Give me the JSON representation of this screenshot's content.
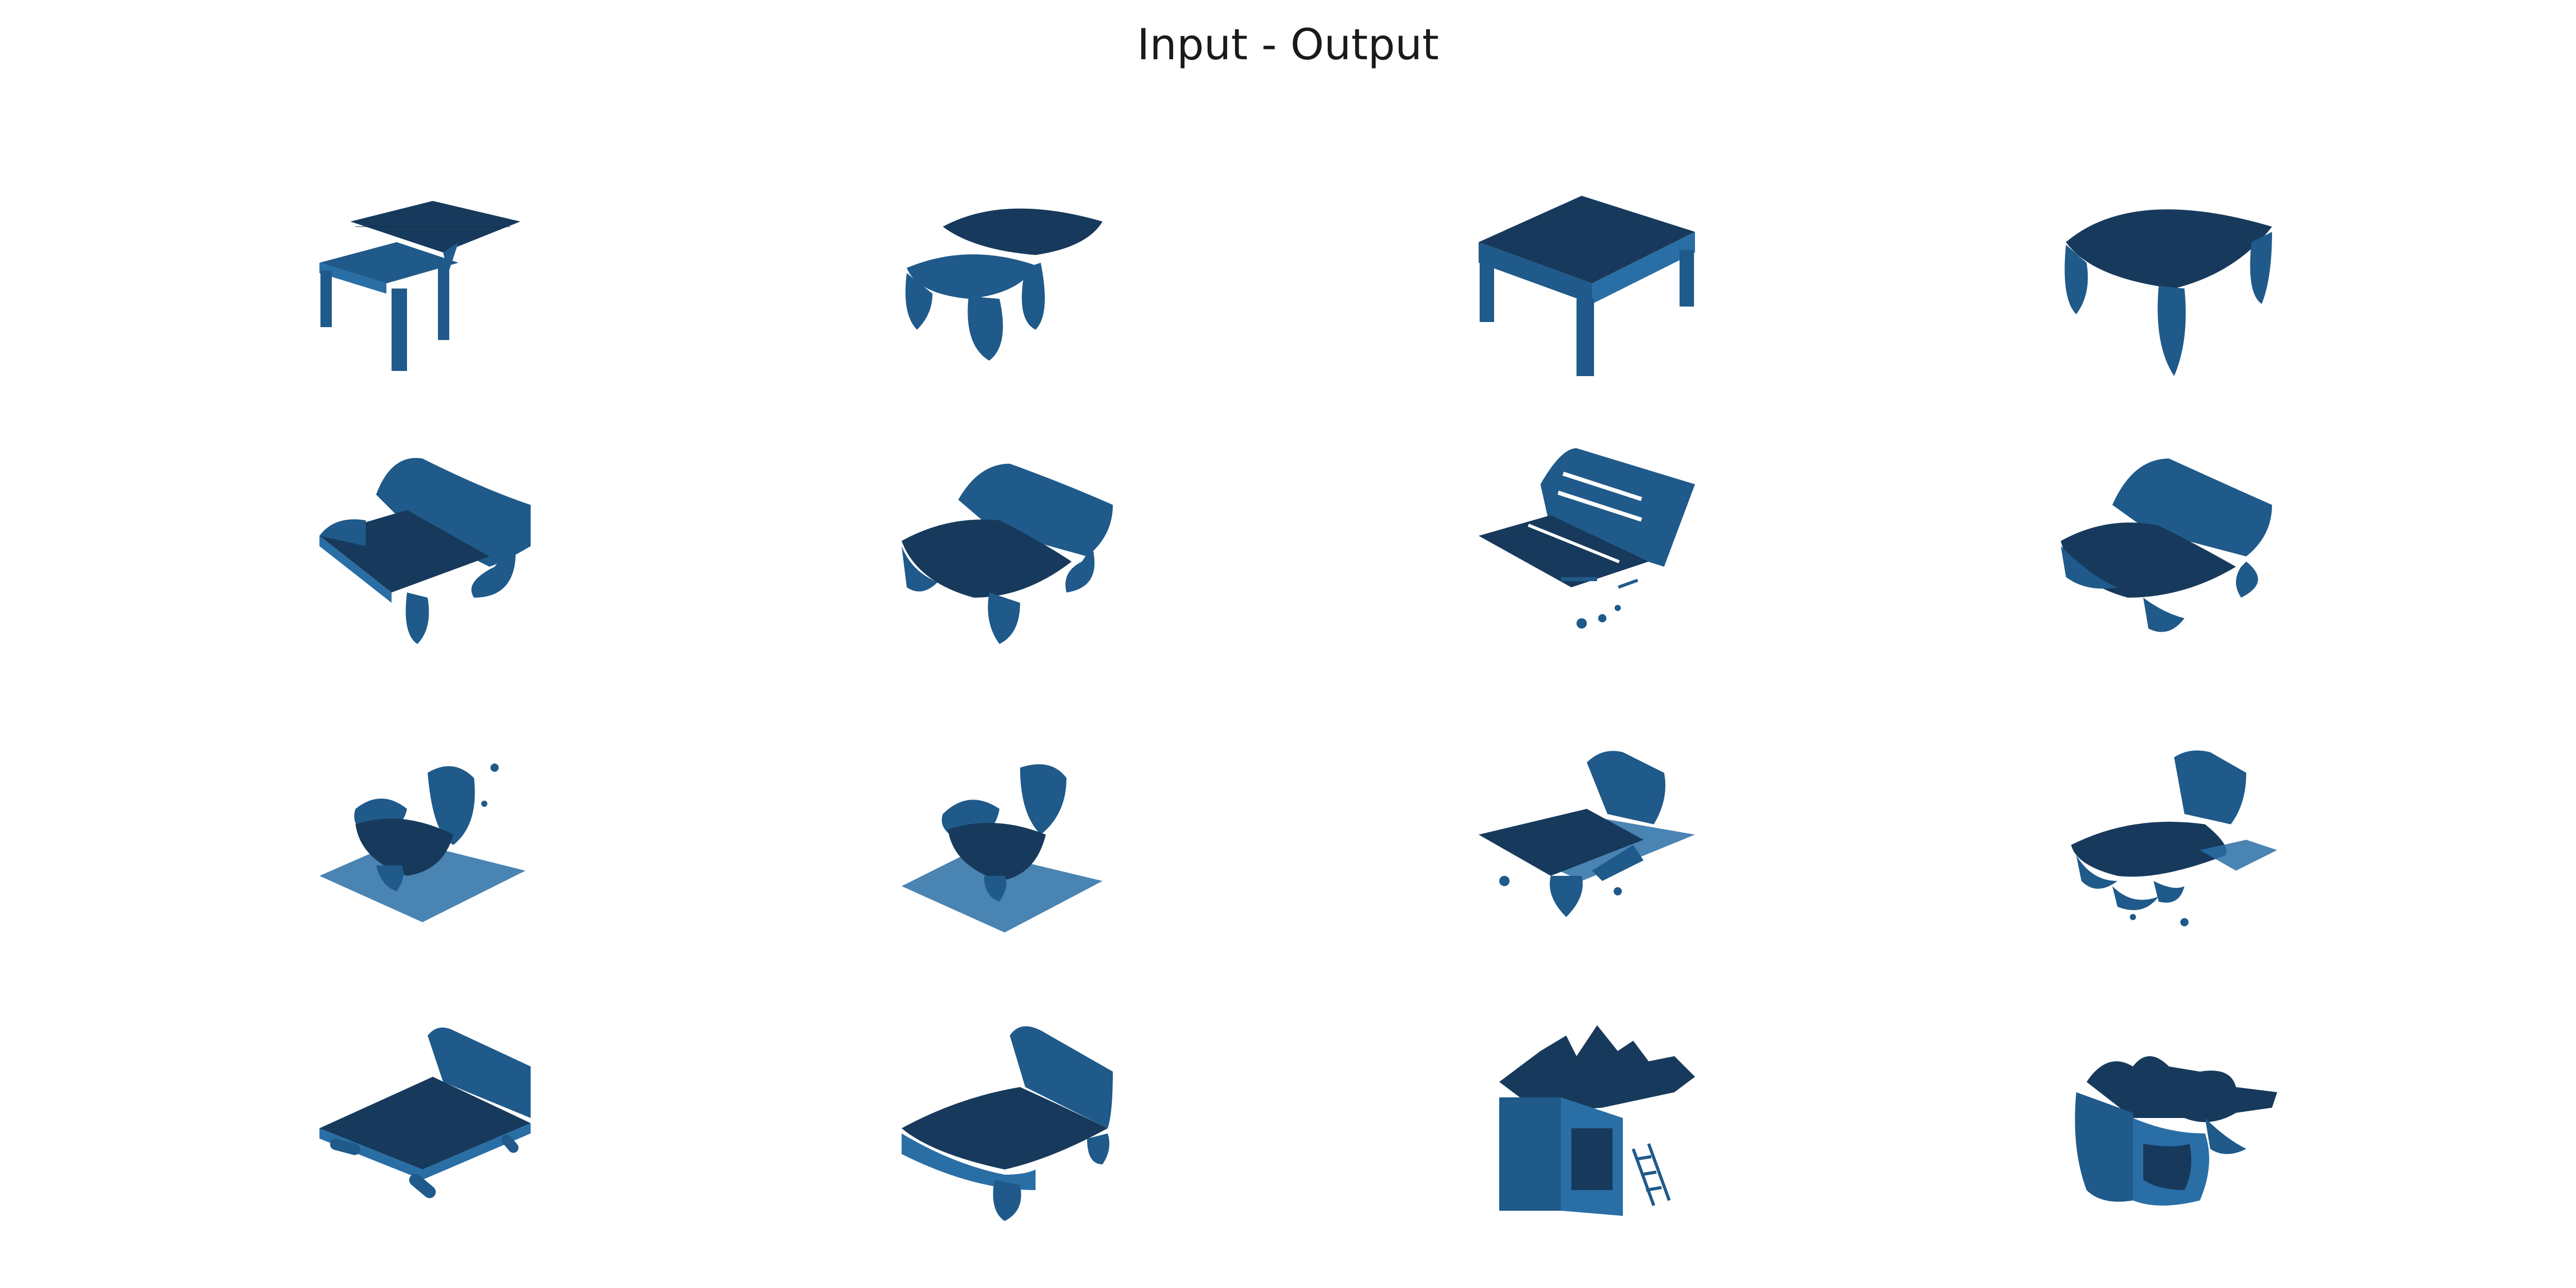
{
  "figure": {
    "title": "Input - Output",
    "mesh_color": "#1f5a8a",
    "rows": [
      {
        "name": "row-1",
        "cells": [
          {
            "shape": "table-with-shelf"
          },
          {
            "shape": "table-blobby-two-tier"
          },
          {
            "shape": "table-square"
          },
          {
            "shape": "table-blobby"
          }
        ]
      },
      {
        "name": "row-2",
        "cells": [
          {
            "shape": "lounge-chair"
          },
          {
            "shape": "lounge-chair-blobby"
          },
          {
            "shape": "slatted-chair-fragmented"
          },
          {
            "shape": "lounge-chair-blobby"
          }
        ]
      },
      {
        "name": "row-3",
        "cells": [
          {
            "shape": "armchair-on-floor"
          },
          {
            "shape": "armchair-blobby-on-floor"
          },
          {
            "shape": "recliner-on-floor"
          },
          {
            "shape": "recliner-blobby-fragmented"
          }
        ]
      },
      {
        "name": "row-4",
        "cells": [
          {
            "shape": "sofa-bed"
          },
          {
            "shape": "sofa-bed-blobby"
          },
          {
            "shape": "cluttered-desk"
          },
          {
            "shape": "cluttered-desk-blobby"
          }
        ]
      }
    ]
  }
}
